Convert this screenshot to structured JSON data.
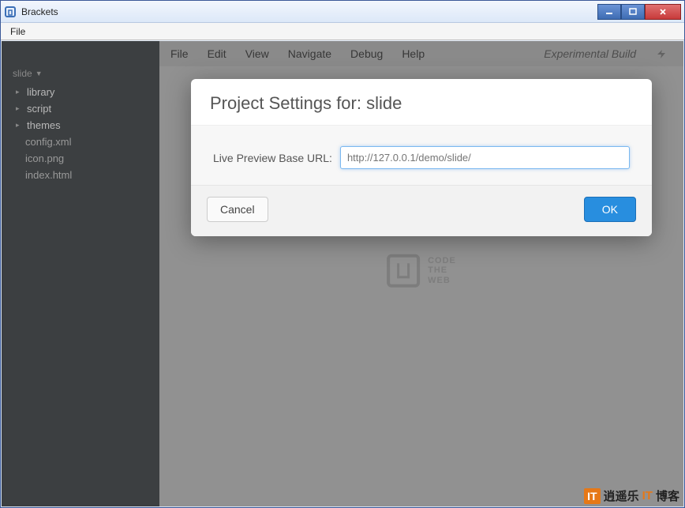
{
  "window": {
    "title": "Brackets"
  },
  "outerMenu": {
    "file": "File"
  },
  "sidebar": {
    "projectName": "slide",
    "items": [
      {
        "label": "library",
        "type": "folder"
      },
      {
        "label": "script",
        "type": "folder"
      },
      {
        "label": "themes",
        "type": "folder"
      },
      {
        "label": "config.xml",
        "type": "file"
      },
      {
        "label": "icon.png",
        "type": "file"
      },
      {
        "label": "index.html",
        "type": "file"
      }
    ]
  },
  "editorMenu": {
    "file": "File",
    "edit": "Edit",
    "view": "View",
    "navigate": "Navigate",
    "debug": "Debug",
    "help": "Help",
    "build": "Experimental Build"
  },
  "brand": {
    "line1": "CODE",
    "line2": "THE",
    "line3": "WEB"
  },
  "modal": {
    "title": "Project Settings for: slide",
    "label": "Live Preview Base URL:",
    "placeholder": "http://127.0.0.1/demo/slide/",
    "value": "",
    "cancel": "Cancel",
    "ok": "OK"
  },
  "watermark": {
    "badge": "IT",
    "text1": "逍遥乐",
    "text2": "IT",
    "text3": "博客"
  }
}
